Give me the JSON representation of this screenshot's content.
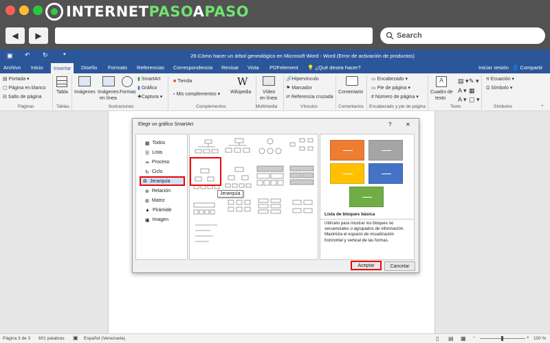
{
  "browser": {
    "logo_text_1": "INTERNET",
    "logo_text_2": "PASO",
    "logo_text_3": "A",
    "logo_text_4": "PASO",
    "search_label": "Search",
    "back_icon": "arrow-left-icon",
    "forward_icon": "arrow-right-icon"
  },
  "word": {
    "title": "26-Cómo hacer un árbol genealógico en Microsoft Word - Word (Error de activación de productos)",
    "tabs": [
      "Archivo",
      "Inicio",
      "Insertar",
      "Diseño",
      "Formato",
      "Referencias",
      "Correspondencia",
      "Revisar",
      "Vista",
      "PDFelement"
    ],
    "tell_me": "¿Qué desea hacer?",
    "signin": "Iniciar sesión",
    "share": "Compartir",
    "ribbon": {
      "paginas": [
        "Portada",
        "Página en blanco",
        "Salto de página"
      ],
      "paginas_label": "Páginas",
      "tabla": "Tabla",
      "tablas_label": "Tablas",
      "imagenes": "Imágenes",
      "imagenes_linea_1": "Imágenes",
      "imagenes_linea_2": "en línea",
      "formas": "Formas",
      "smartart": "SmartArt",
      "grafico": "Gráfico",
      "captura": "Captura",
      "ilustraciones_label": "Ilustraciones",
      "tienda": "Tienda",
      "mis_complementos": "Mis complementos",
      "wikipedia": "Wikipedia",
      "complementos_label": "Complementos",
      "video_1": "Vídeo",
      "video_2": "en línea",
      "multimedia_label": "Multimedia",
      "hipervinculo": "Hipervínculo",
      "marcador": "Marcador",
      "referencia": "Referencia cruzada",
      "vinculos_label": "Vínculos",
      "comentario": "Comentario",
      "comentarios_label": "Comentarios",
      "encabezado": "Encabezado",
      "pie": "Pie de página",
      "numero": "Número de página",
      "encab_label": "Encabezado y pie de página",
      "cuadro_1": "Cuadro de",
      "cuadro_2": "texto",
      "texto_label": "Texto",
      "ecuacion": "Ecuación",
      "simbolo": "Símbolo",
      "simbolos_label": "Símbolos"
    },
    "status": {
      "page": "Página 3 de 3",
      "words": "601 palabras",
      "lang": "Español (Venezuela)",
      "zoom": "100 %"
    }
  },
  "dialog": {
    "title": "Elegir un gráfico SmartArt",
    "help": "?",
    "close": "✕",
    "categories": [
      "Todos",
      "Lista",
      "Proceso",
      "Ciclo",
      "Jerarquía",
      "Relación",
      "Matriz",
      "Pirámide",
      "Imagen"
    ],
    "selected_category": "Jerarquía",
    "tooltip": "Jerarquía",
    "preview_title": "Lista de bloques básica",
    "preview_desc": "Utilícelo para mostrar los bloques no secuenciales o agrupados de información. Maximiza el espacio de visualización horizontal y vertical de las formas.",
    "ok": "Aceptar",
    "cancel": "Cancelar",
    "block_colors": [
      "#ed7d31",
      "#a5a5a5",
      "#ffc000",
      "#4472c4",
      "#70ad47"
    ]
  }
}
